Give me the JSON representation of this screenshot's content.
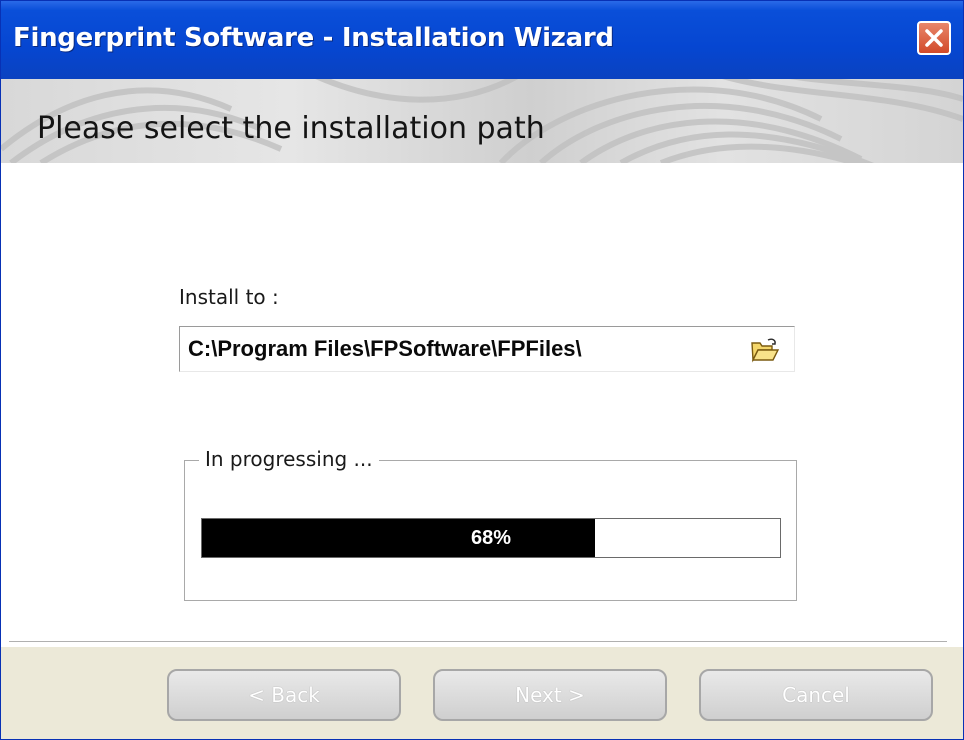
{
  "window": {
    "title": "Fingerprint Software - Installation Wizard",
    "close_icon": "close-icon"
  },
  "banner": {
    "heading": "Please select the installation path"
  },
  "install": {
    "label": "Install to :",
    "path": "C:\\Program Files\\FPSoftware\\FPFiles\\",
    "browse_icon": "folder-open-icon"
  },
  "progress": {
    "group_label": "In progressing ...",
    "percent_text": "68%",
    "percent_value": 0.68
  },
  "buttons": {
    "back": "< Back",
    "next": "Next >",
    "cancel": "Cancel"
  },
  "colors": {
    "titlebar": "#0646d1",
    "close_button": "#d24a2a",
    "progress_fill": "#000000",
    "footer": "#ece9d8"
  }
}
